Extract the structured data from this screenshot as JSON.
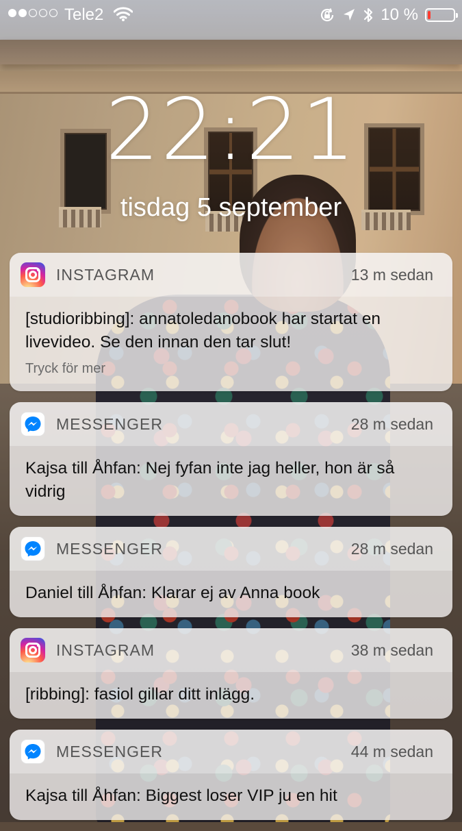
{
  "status_bar": {
    "carrier": "Tele2",
    "signal_bars_filled": 2,
    "signal_bars_total": 5,
    "battery_percent": "10 %",
    "battery_level": 0.1,
    "icons": [
      "wifi-icon",
      "rotation-lock-icon",
      "location-arrow-icon",
      "bluetooth-icon",
      "battery-icon"
    ]
  },
  "lock_screen": {
    "time": "22:21",
    "date": "tisdag 5 september"
  },
  "notifications": [
    {
      "app": "INSTAGRAM",
      "icon": "instagram-icon",
      "time": "13 m sedan",
      "message": "[studioribbing]: annatoledanobook har startat en livevideo. Se den innan den tar slut!",
      "more": "Tryck för mer"
    },
    {
      "app": "MESSENGER",
      "icon": "messenger-icon",
      "time": "28 m sedan",
      "message": "Kajsa till Åhfan: Nej fyfan inte jag heller, hon är så vidrig"
    },
    {
      "app": "MESSENGER",
      "icon": "messenger-icon",
      "time": "28 m sedan",
      "message": "Daniel till Åhfan: Klarar ej av Anna book"
    },
    {
      "app": "INSTAGRAM",
      "icon": "instagram-icon",
      "time": "38 m sedan",
      "message": "[ribbing]: fasiol gillar ditt inlägg."
    },
    {
      "app": "MESSENGER",
      "icon": "messenger-icon",
      "time": "44 m sedan",
      "message": "Kajsa till Åhfan: Biggest loser VIP ju en hit"
    }
  ],
  "colors": {
    "battery_low": "#ff3b30",
    "messenger_blue": "#0084ff",
    "text_primary": "#111111",
    "text_secondary": "#555555"
  }
}
